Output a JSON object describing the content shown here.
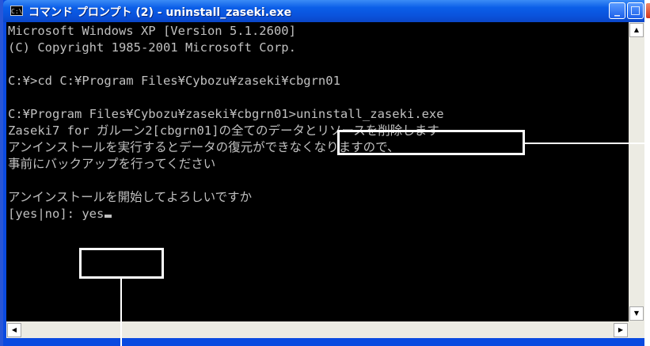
{
  "window": {
    "title": "コマンド プロンプト (2) - uninstall_zaseki.exe",
    "icon": "cmd-icon",
    "icon_text": "C:\\",
    "buttons": {
      "minimize": "_",
      "maximize": "□",
      "close": "×"
    }
  },
  "console": {
    "lines": [
      "Microsoft Windows XP [Version 5.1.2600]",
      "(C) Copyright 1985-2001 Microsoft Corp.",
      "",
      "C:¥>cd C:¥Program Files¥Cybozu¥zaseki¥cbgrn01",
      "",
      "C:¥Program Files¥Cybozu¥zaseki¥cbgrn01>uninstall_zaseki.exe",
      "Zaseki7 for ガルーン2[cbgrn01]の全てのデータとリソースを削除します",
      "アンインストールを実行するとデータの復元ができなくなりますので、",
      "事前にバックアップを行ってください",
      "",
      "アンインストールを開始してよろしいですか",
      "[yes|no]: yes"
    ]
  },
  "scrollbars": {
    "up_arrow": "▲",
    "down_arrow": "▼",
    "left_arrow": "◀",
    "right_arrow": "▶"
  },
  "colors": {
    "titlebar": "#0a53dc",
    "console_bg": "#000000",
    "console_text": "#c0c0c0",
    "callout": "#ffffff"
  }
}
